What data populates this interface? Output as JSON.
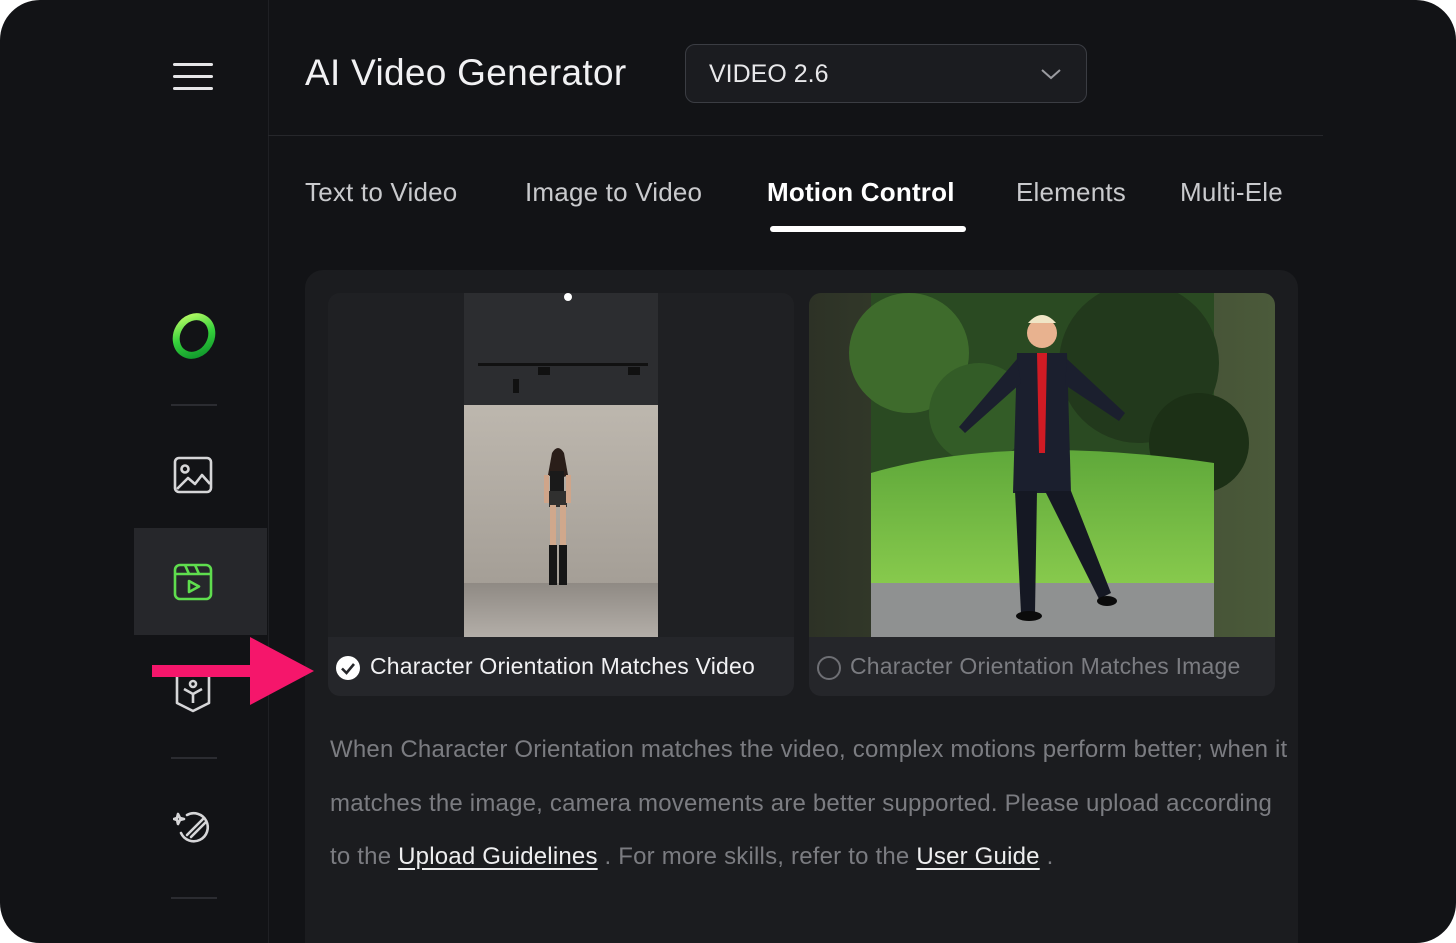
{
  "header": {
    "title": "AI Video Generator",
    "model_select": {
      "value": "VIDEO 2.6"
    }
  },
  "sidebar": {
    "items": [
      {
        "icon": "menu-icon"
      },
      {
        "icon": "logo-ring-icon"
      },
      {
        "icon": "image-icon"
      },
      {
        "icon": "video-icon",
        "active": true
      },
      {
        "icon": "avatar-icon"
      },
      {
        "icon": "magic-edit-icon"
      }
    ]
  },
  "tabs": [
    {
      "label": "Text to Video"
    },
    {
      "label": "Image to Video"
    },
    {
      "label": "Motion Control",
      "active": true
    },
    {
      "label": "Elements"
    },
    {
      "label": "Multi-Ele"
    }
  ],
  "options": [
    {
      "label": "Character Orientation Matches Video",
      "selected": true
    },
    {
      "label": "Character Orientation Matches Image",
      "selected": false
    }
  ],
  "description": {
    "part1": "When Character Orientation matches the video, complex motions perform better; when it matches the image, camera movements are better supported. Please upload according to the ",
    "link1": "Upload Guidelines",
    "part2": " . For more skills, refer to the ",
    "link2": "User Guide",
    "part3": " ."
  },
  "colors": {
    "background": "#121316",
    "accent_green": "#5fdd4e",
    "annotation_arrow": "#f5166b"
  }
}
